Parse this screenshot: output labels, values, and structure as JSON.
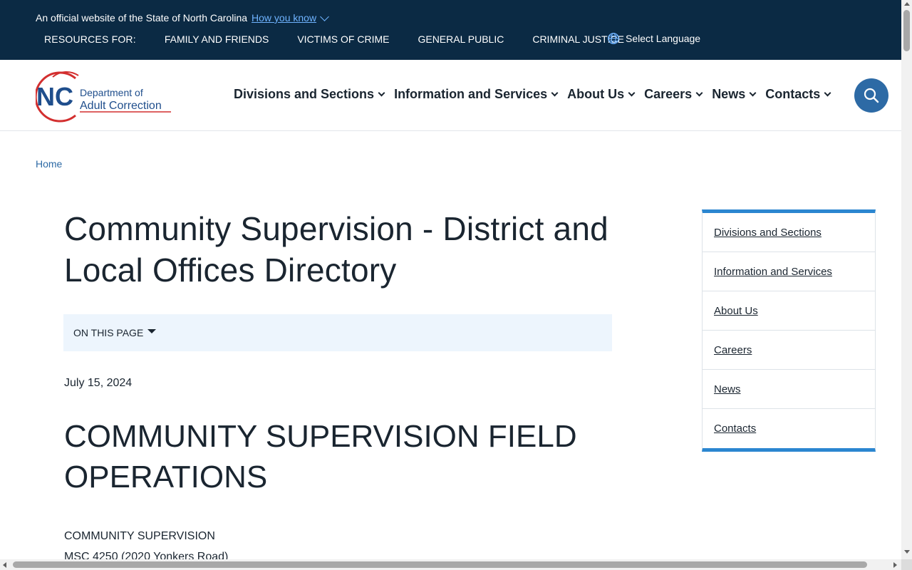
{
  "gov_banner": {
    "official_text": "An official website of the State of North Carolina",
    "how_you_know": "How you know",
    "resources_label": "RESOURCES FOR:",
    "resource_links": [
      "FAMILY AND FRIENDS",
      "VICTIMS OF CRIME",
      "GENERAL PUBLIC",
      "CRIMINAL JUSTICE"
    ],
    "language_label": "Select Language",
    "language_icon": "globe-icon",
    "background_color": "#0b2a44"
  },
  "header": {
    "logo": {
      "mark": "NC",
      "line1": "Department of",
      "line2": "Adult Correction"
    },
    "nav": [
      "Divisions and Sections",
      "Information and Services",
      "About Us",
      "Careers",
      "News",
      "Contacts"
    ],
    "search_icon": "search-icon",
    "accent_color": "#2d6aa5"
  },
  "breadcrumb": {
    "home": "Home"
  },
  "main": {
    "title": "Community Supervision - District and Local Offices Directory",
    "on_this_page": "ON THIS PAGE",
    "date": "July 15, 2024",
    "section_heading": "COMMUNITY SUPERVISION FIELD OPERATIONS",
    "address_line1": "COMMUNITY SUPERVISION",
    "address_line2": "MSC 4250 (2020 Yonkers Road)"
  },
  "side_menu": {
    "items": [
      "Divisions and Sections",
      "Information and Services",
      "About Us",
      "Careers",
      "News",
      "Contacts"
    ],
    "accent_color": "#2b86d0"
  }
}
